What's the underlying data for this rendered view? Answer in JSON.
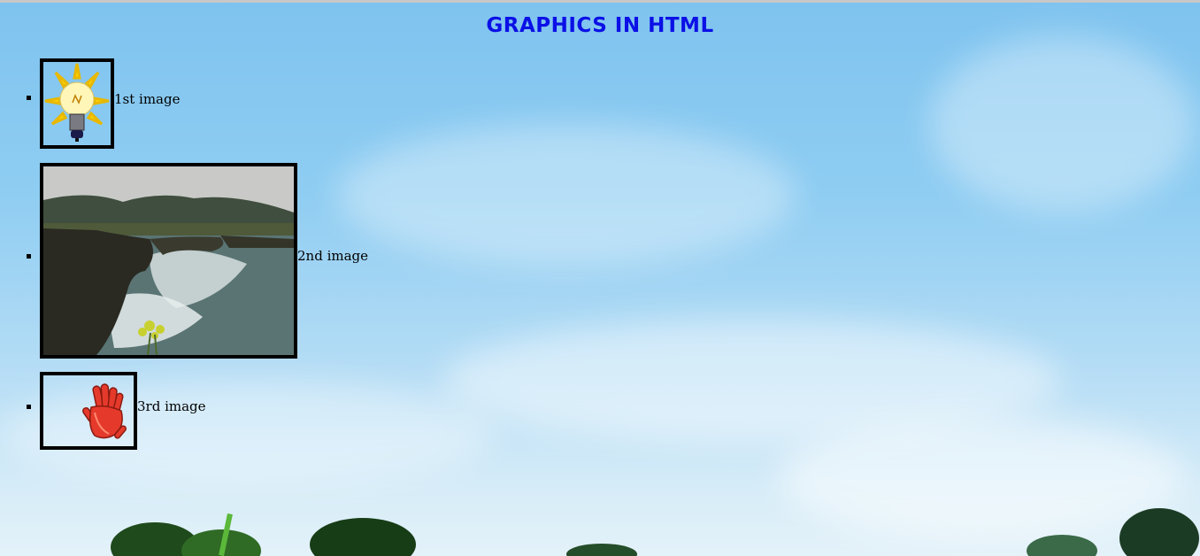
{
  "page": {
    "title": "GRAPHICS IN HTML"
  },
  "images": [
    {
      "caption": "1st image",
      "icon": "lightbulb-icon"
    },
    {
      "caption": "2nd image",
      "icon": "sea-cliff-photo"
    },
    {
      "caption": "3rd image",
      "icon": "red-hand-icon"
    }
  ],
  "colors": {
    "title": "#0b10e6",
    "sky": "#8fcdf2",
    "frame": "#000000"
  }
}
